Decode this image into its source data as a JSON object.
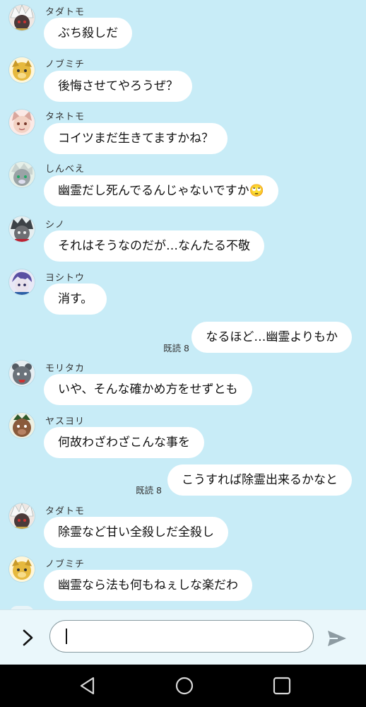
{
  "messages": [
    {
      "sender": "タダトモ",
      "text": "ぶち殺しだ",
      "avatar": "white-haired-wolf-avatar"
    },
    {
      "sender": "ノブミチ",
      "text": "後悔させてやろうぜ？",
      "avatar": "yellow-dog-avatar"
    },
    {
      "sender": "タネトモ",
      "text": "コイツまだ生きてますかね？",
      "avatar": "pink-cat-avatar"
    },
    {
      "sender": "しんべえ",
      "text": "幽霊だし死んでるんじゃないですか",
      "emoji": "🙄",
      "avatar": "grey-wolf-avatar"
    },
    {
      "sender": "シノ",
      "text": "それはそうなのだが…なんたる不敬",
      "avatar": "dark-haired-wolf-avatar"
    },
    {
      "sender": "ヨシトウ",
      "text": "消す。",
      "avatar": "purple-haired-avatar"
    },
    {
      "outgoing": true,
      "read": "既読 8",
      "text": "なるほど…幽霊よりもか"
    },
    {
      "sender": "モリタカ",
      "text": "いや、そんな確かめ方をせずとも",
      "avatar": "grey-bear-avatar"
    },
    {
      "sender": "ヤスヨリ",
      "text": "何故わざわざこんな事を",
      "avatar": "brown-boar-avatar"
    },
    {
      "outgoing": true,
      "read": "既読 8",
      "text": "こうすれば除霊出来るかなと"
    },
    {
      "sender": "タダトモ",
      "text": "除霊など甘い全殺しだ全殺し",
      "avatar": "white-haired-wolf-avatar"
    },
    {
      "sender": "ノブミチ",
      "text": "幽霊なら法も何もねぇしな楽だわ",
      "avatar": "yellow-dog-avatar"
    }
  ],
  "input": {
    "value": "",
    "expand_icon": "chevron-right-icon",
    "send_icon": "send-icon"
  },
  "nav": {
    "back_icon": "back-triangle-icon",
    "home_icon": "home-circle-icon",
    "recents_icon": "recents-square-icon"
  },
  "colors": {
    "background": "#c8ecf7",
    "bubble": "#ffffff",
    "nav": "#000000"
  }
}
